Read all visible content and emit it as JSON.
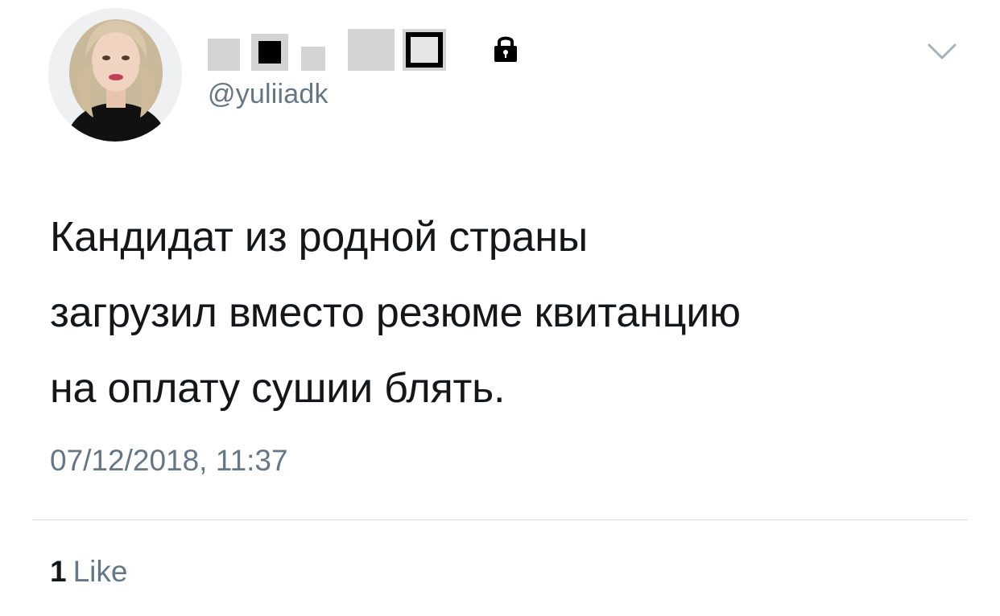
{
  "user": {
    "handle": "@yuliiadk",
    "display_name_redacted": true,
    "protected_account": true
  },
  "icons": {
    "lock": "lock-icon",
    "menu": "chevron-down-icon",
    "avatar": "avatar-photo"
  },
  "tweet": {
    "text": "Кандидат из родной страны\nзагрузил вместо резюме квитанцию\nна оплату сушии блять.",
    "timestamp": "07/12/2018, 11:37"
  },
  "stats": {
    "likes_count": "1",
    "likes_label": "Like"
  },
  "colors": {
    "text_primary": "#14171a",
    "text_secondary": "#657786",
    "divider": "#d6dbe0",
    "background": "#ffffff"
  }
}
